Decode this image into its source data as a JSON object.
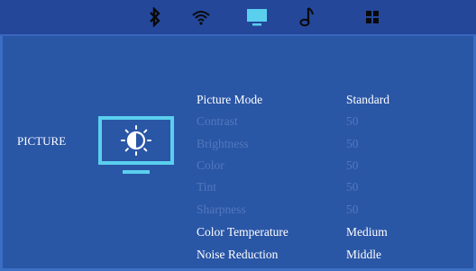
{
  "colors": {
    "background": "#2a56a6",
    "topbar": "#24479a",
    "icon_active": "#5ad0ee",
    "text_enabled": "#ffffff",
    "text_disabled": "#5378bb"
  },
  "tabs": [
    {
      "icon": "bluetooth-icon",
      "active": false
    },
    {
      "icon": "wifi-icon",
      "active": false
    },
    {
      "icon": "tv-icon",
      "active": true
    },
    {
      "icon": "music-note-icon",
      "active": false
    },
    {
      "icon": "apps-grid-icon",
      "active": false
    }
  ],
  "sidebar": {
    "section_label": "PICTURE",
    "icon": "brightness-monitor-icon"
  },
  "menu": {
    "items": [
      {
        "label": "Picture Mode",
        "value": "Standard",
        "enabled": true
      },
      {
        "label": "Contrast",
        "value": "50",
        "enabled": false
      },
      {
        "label": "Brightness",
        "value": "50",
        "enabled": false
      },
      {
        "label": "Color",
        "value": "50",
        "enabled": false
      },
      {
        "label": "Tint",
        "value": "50",
        "enabled": false
      },
      {
        "label": "Sharpness",
        "value": "50",
        "enabled": false
      },
      {
        "label": "Color Temperature",
        "value": "Medium",
        "enabled": true
      },
      {
        "label": "Noise Reduction",
        "value": "Middle",
        "enabled": true
      }
    ]
  }
}
